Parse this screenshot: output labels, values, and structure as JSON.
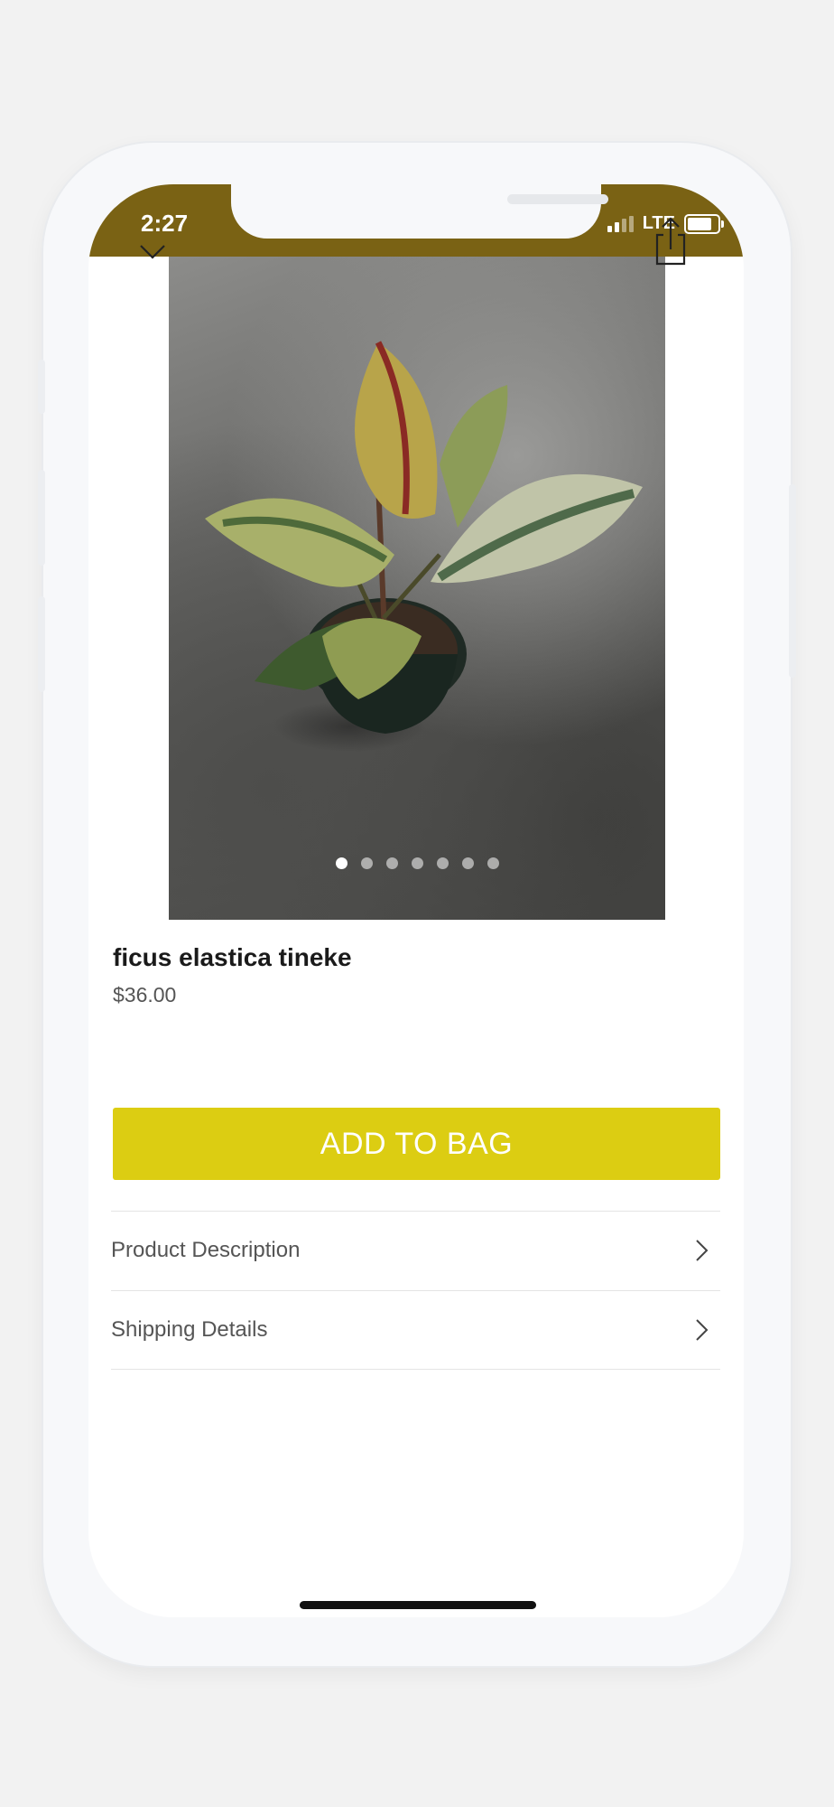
{
  "status_bar": {
    "time": "2:27",
    "network": "LTE",
    "background": "#7a6214"
  },
  "nav": {
    "back_icon": "chevron-down-icon",
    "share_icon": "share-icon"
  },
  "gallery": {
    "image": "ficus plant in pot on concrete floor",
    "page_count": 7,
    "current_page": 1
  },
  "product": {
    "name": "ficus elastica tineke",
    "price": "$36.00"
  },
  "actions": {
    "add_to_bag": "ADD TO BAG",
    "button_color": "#dccd12"
  },
  "details": [
    {
      "label": "Product Description"
    },
    {
      "label": "Shipping Details"
    }
  ]
}
